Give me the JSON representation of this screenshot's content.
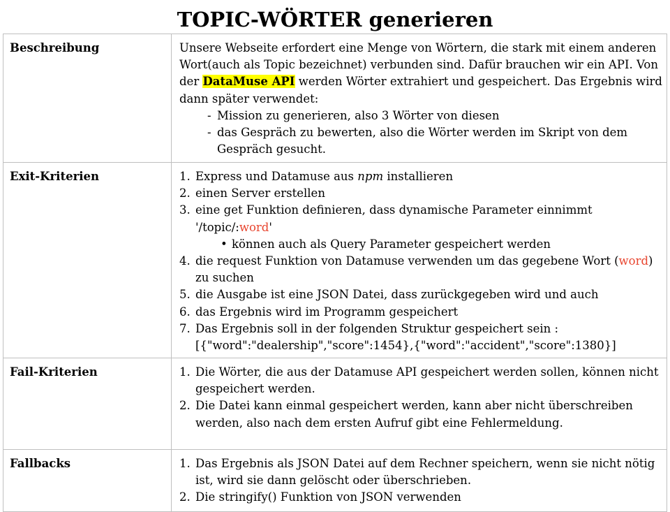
{
  "title": "TOPIC-WÖRTER generieren",
  "rows": {
    "beschreibung": {
      "label": "Beschreibung",
      "text_before": "Unsere Webseite erfordert eine Menge von Wörtern, die stark mit einem anderen Wort(auch als Topic bezeichnet) verbunden sind. Dafür brauchen wir ein API. Von der ",
      "highlight": "DataMuse API",
      "text_after": " werden Wörter extrahiert und gespeichert. Das Ergebnis wird dann später verwendet:",
      "bullet_marker": "-",
      "bullets": [
        "Mission zu generieren, also 3 Wörter von diesen",
        "das Gespräch zu bewerten, also die Wörter werden im Skript von dem Gespräch gesucht."
      ]
    },
    "exit": {
      "label": "Exit-Kriterien",
      "item1_before": "Express und Datamuse aus ",
      "item1_em": "npm",
      "item1_after": " installieren",
      "item2": "einen Server erstellen",
      "item3_line": "eine get Funktion definieren, dass dynamische Parameter einnimmt",
      "item3_route_prefix": "'/topic/:",
      "item3_route_word": "word",
      "item3_route_suffix": "'",
      "item3_sub_marker": "•",
      "item3_sub": "können auch als Query Parameter gespeichert werden",
      "item4_before": "die request Funktion von Datamuse verwenden um das gegebene Wort (",
      "item4_word": "word",
      "item4_after": ") zu suchen",
      "item5": "die Ausgabe ist eine JSON Datei, dass zurückgegeben wird und auch",
      "item6": "das Ergebnis wird im Programm gespeichert",
      "item7": "Das Ergebnis soll in der folgenden Struktur gespeichert sein : [{\"word\":\"dealership\",\"score\":1454},{\"word\":\"accident\",\"score\":1380}]"
    },
    "fail": {
      "label": "Fail-Kriterien",
      "items": [
        "Die Wörter, die aus der Datamuse API gespeichert werden sollen, können nicht gespeichert werden.",
        "Die Datei kann einmal gespeichert werden, kann aber nicht überschreiben werden, also nach dem ersten Aufruf gibt eine Fehlermeldung."
      ]
    },
    "fallbacks": {
      "label": "Fallbacks",
      "items": [
        "Das Ergebnis als JSON Datei auf dem Rechner speichern, wenn sie nicht nötig ist, wird sie dann gelöscht oder überschrieben.",
        "Die stringify() Funktion von JSON verwenden"
      ]
    }
  },
  "numbers": [
    "1.",
    "2.",
    "3.",
    "4.",
    "5.",
    "6.",
    "7."
  ],
  "colors": {
    "highlight": "#ffff00",
    "accent_word": "#e8452f",
    "border": "#bfbfbf"
  }
}
